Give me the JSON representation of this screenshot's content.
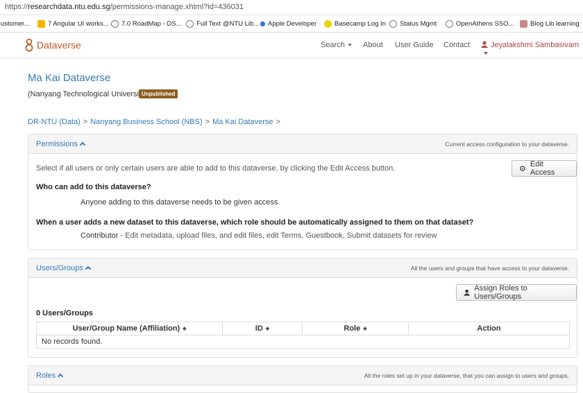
{
  "browser": {
    "url_prefix": "https://",
    "url_host": "researchdata.ntu.edu.sg",
    "url_path": "/permissions-manage.xhtml?id=436031",
    "bookmarks": [
      {
        "label": "Customer...",
        "color": "#6b8fc7"
      },
      {
        "label": "7 Angular UI works...",
        "color": "#f2b600"
      },
      {
        "label": "7.0 RoadMap - DS...",
        "color": "#777777"
      },
      {
        "label": "Full Text @NTU Lib...",
        "color": "#777777"
      },
      {
        "label": "Apple Developer",
        "color": "#2f6fd6"
      },
      {
        "label": "Basecamp Log In",
        "color": "#b6a800"
      },
      {
        "label": "Status Mgmt",
        "color": "#777777"
      },
      {
        "label": "OpenAthens SSO...",
        "color": "#777777"
      },
      {
        "label": "Blog Lib learning",
        "color": "#a05050"
      }
    ]
  },
  "navbar": {
    "brand": "Dataverse",
    "search": "Search",
    "about": "About",
    "user_guide": "User Guide",
    "contact": "Contact",
    "user": "Jeyalakshmi Sambasivam"
  },
  "dataverse": {
    "title": "Ma Kai Dataverse",
    "affiliation": "(Nanyang Technological University)",
    "status_badge": "Unpublished"
  },
  "breadcrumb": {
    "items": [
      "DR-NTU (Data)",
      "Nanyang Business School (NBS)",
      "Ma Kai Dataverse"
    ],
    "separator": ">"
  },
  "permissions": {
    "title": "Permissions",
    "note": "Current access configuration to your dataverse.",
    "intro": "Select if all users or only certain users are able to add to this dataverse, by clicking the Edit Access button.",
    "edit_button": "Edit Access",
    "who_heading": "Who can add to this dataverse?",
    "who_value": "Anyone adding to this dataverse needs to be given access",
    "role_heading": "When a user adds a new dataset to this dataverse, which role should be automatically assigned to them on that dataset?",
    "role_name": "Contributor",
    "role_desc": " - Edit metadata, upload files, and edit files, edit Terms, Guestbook, Submit datasets for review"
  },
  "users_groups": {
    "title": "Users/Groups",
    "note": "All the users and groups that have access to your dataverse.",
    "assign_button": "Assign Roles to Users/Groups",
    "count": "0 Users/Groups",
    "columns": [
      "User/Group Name (Affiliation)",
      "ID",
      "Role",
      "Action"
    ],
    "empty": "No records found."
  },
  "roles": {
    "title": "Roles",
    "note": "All the roles set up in your dataverse, that you can assign to users and groups."
  }
}
